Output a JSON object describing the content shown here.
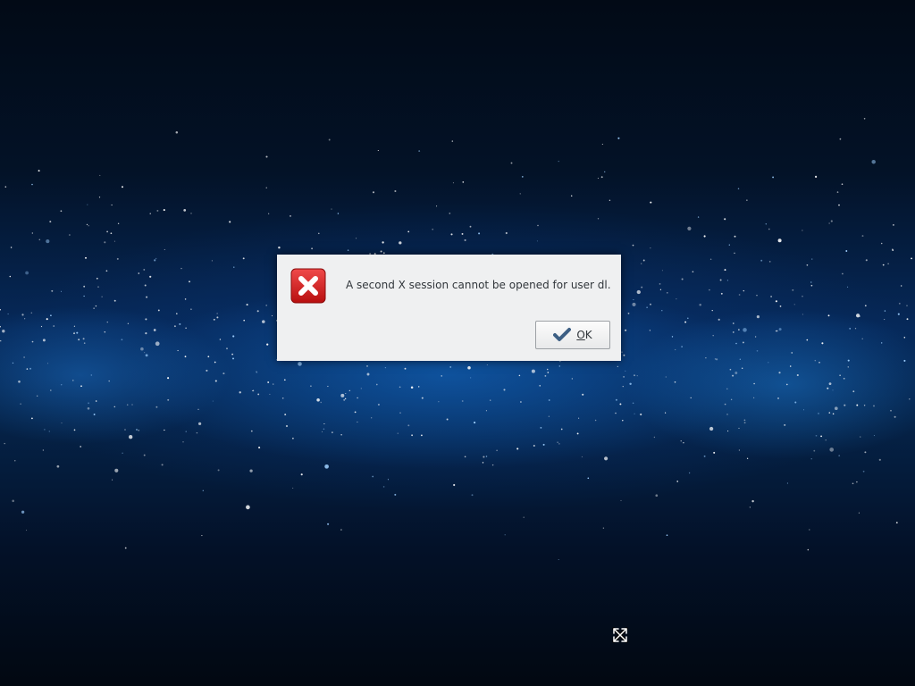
{
  "dialog": {
    "message": "A second X session cannot be opened for user dl.",
    "icon": "error-icon",
    "ok_button": {
      "mnemonic": "O",
      "rest": "K",
      "icon": "checkmark-icon"
    }
  },
  "cursor": {
    "icon": "move-cursor-icon"
  },
  "colors": {
    "dialog_bg": "#eff0f1",
    "error_red": "#d11b1b",
    "text": "#31363b",
    "check_blue": "#3d5f84"
  }
}
